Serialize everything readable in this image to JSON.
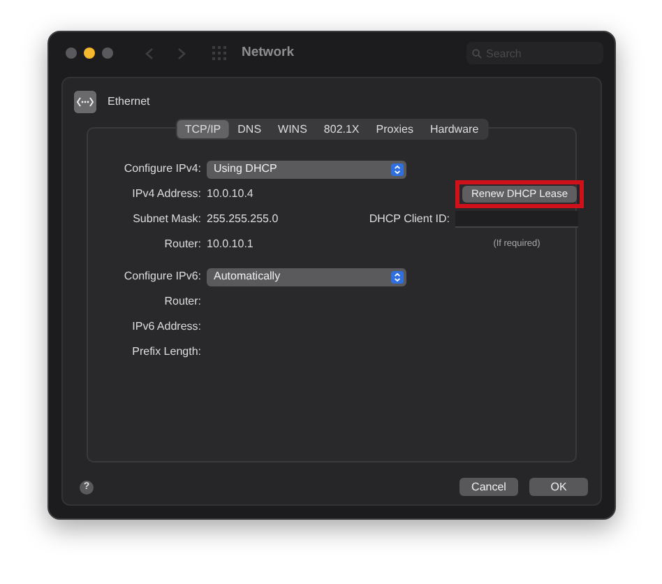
{
  "window": {
    "title": "Network",
    "traffic_lights": [
      {
        "color": "#5a5a5e"
      },
      {
        "color": "#f5b82e"
      },
      {
        "color": "#5a5a5e"
      }
    ]
  },
  "search": {
    "placeholder": "Search"
  },
  "service": {
    "name": "Ethernet"
  },
  "tabs": [
    {
      "label": "TCP/IP",
      "selected": true
    },
    {
      "label": "DNS",
      "selected": false
    },
    {
      "label": "WINS",
      "selected": false
    },
    {
      "label": "802.1X",
      "selected": false
    },
    {
      "label": "Proxies",
      "selected": false
    },
    {
      "label": "Hardware",
      "selected": false
    }
  ],
  "ipv4": {
    "configure_label": "Configure IPv4:",
    "configure_value": "Using DHCP",
    "rows": [
      {
        "label": "IPv4 Address:",
        "value": "10.0.10.4"
      },
      {
        "label": "Subnet Mask:",
        "value": "255.255.255.0"
      },
      {
        "label": "Router:",
        "value": "10.0.10.1"
      }
    ],
    "renew_button": "Renew DHCP Lease",
    "renew_highlighted": true,
    "client_id_label": "DHCP Client ID:",
    "client_id_hint": "(If required)"
  },
  "ipv6": {
    "configure_label": "Configure IPv6:",
    "configure_value": "Automatically",
    "rows": [
      {
        "label": "Router:"
      },
      {
        "label": "IPv6 Address:"
      },
      {
        "label": "Prefix Length:"
      }
    ]
  },
  "help": "?",
  "buttons": [
    "Cancel",
    "OK"
  ]
}
